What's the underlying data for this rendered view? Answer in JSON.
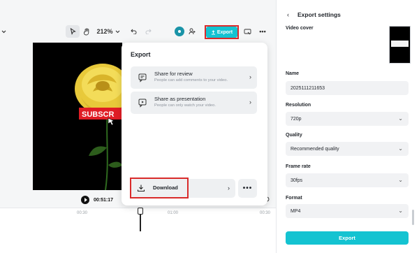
{
  "toolbar": {
    "zoom": "212%",
    "export_label": "Export"
  },
  "player": {
    "current_time": "00:51:17"
  },
  "timeline": {
    "ticks": [
      "00:30",
      "01:00",
      "00:30",
      "01:00",
      "00:30"
    ]
  },
  "export_popup": {
    "title": "Export",
    "options": [
      {
        "title": "Share for review",
        "description": "People can add comments to your video."
      },
      {
        "title": "Share as presentation",
        "description": "People can only watch your video."
      }
    ],
    "download_label": "Download",
    "more_label": "•••"
  },
  "settings": {
    "title": "Export settings",
    "video_cover_label": "Video cover",
    "name_label": "Name",
    "name_value": "2025111211653",
    "resolution_label": "Resolution",
    "resolution_value": "720p",
    "quality_label": "Quality",
    "quality_value": "Recommended quality",
    "frame_rate_label": "Frame rate",
    "frame_rate_value": "30fps",
    "format_label": "Format",
    "format_value": "MP4",
    "export_button": "Export"
  },
  "colors": {
    "accent": "#14c3d1",
    "highlight": "#d92b2b"
  },
  "icons": [
    "chevron-down-icon",
    "pointer-icon",
    "hand-icon",
    "undo-icon",
    "redo-icon",
    "add-user-icon",
    "screen-icon",
    "more-icon",
    "comment-icon",
    "present-icon",
    "download-icon",
    "chevron-right-icon",
    "back-chevron-icon",
    "play-icon"
  ]
}
